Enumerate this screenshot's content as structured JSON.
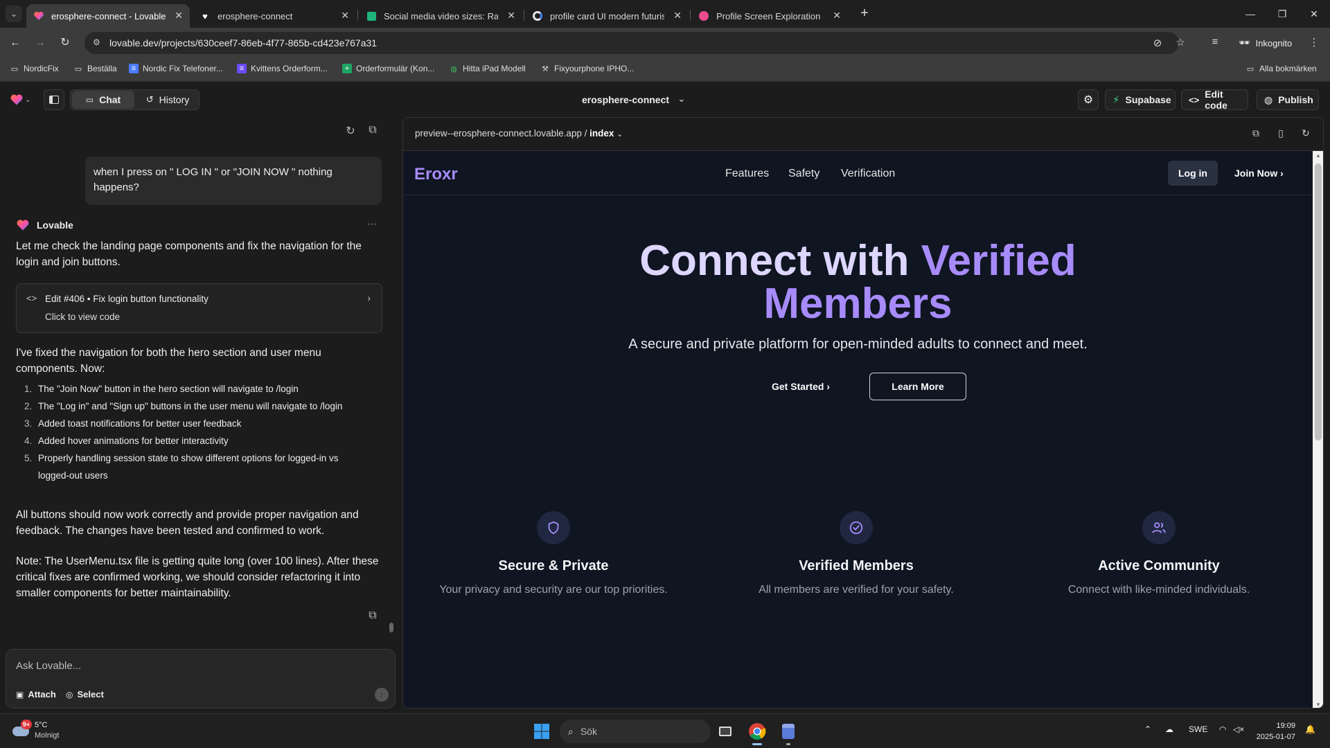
{
  "browser": {
    "tabs": [
      {
        "title": "erosphere-connect - Lovable",
        "icon": "lovable-heart-icon",
        "active": true
      },
      {
        "title": "erosphere-connect",
        "icon": "heart-icon",
        "active": false
      },
      {
        "title": "Social media video sizes: Ratios...",
        "icon": "sheet-icon",
        "active": false
      },
      {
        "title": "profile card UI modern futuristic",
        "icon": "google-icon",
        "active": false
      },
      {
        "title": "Profile Screen Explorations by T...",
        "icon": "dribbble-icon",
        "active": false
      }
    ],
    "url": "lovable.dev/projects/630ceef7-86eb-4f77-865b-cd423e767a31",
    "incognito_label": "Inkognito",
    "bookmarks": [
      {
        "label": "NordicFix",
        "icon": "folder-icon"
      },
      {
        "label": "Beställa",
        "icon": "folder-icon"
      },
      {
        "label": "Nordic Fix Telefoner...",
        "icon": "doc-icon"
      },
      {
        "label": "Kvittens Orderform...",
        "icon": "form-icon"
      },
      {
        "label": "Orderformulär (Kon...",
        "icon": "sheet-icon"
      },
      {
        "label": "Hitta iPad Modell",
        "icon": "globe-icon"
      },
      {
        "label": "Fixyourphone IPHO...",
        "icon": "tool-icon"
      }
    ],
    "all_bookmarks_label": "Alla bokmärken"
  },
  "app": {
    "tabs": {
      "chat": "Chat",
      "history": "History"
    },
    "project_name": "erosphere-connect",
    "actions": {
      "supabase": "Supabase",
      "edit_code": "Edit code",
      "publish": "Publish"
    }
  },
  "chat": {
    "user_message": "when I press on \" LOG IN \" or \"JOIN NOW \" nothing happens?",
    "author": "Lovable",
    "intro": "Let me check the landing page components and fix the navigation for the login and join buttons.",
    "edit_card": {
      "title": "Edit #406 • Fix login button functionality",
      "subtitle": "Click to view code"
    },
    "summary": "I've fixed the navigation for both the hero section and user menu components. Now:",
    "list": [
      "The \"Join Now\" button in the hero section will navigate to /login",
      "The \"Log in\" and \"Sign up\" buttons in the user menu will navigate to /login",
      "Added toast notifications for better user feedback",
      "Added hover animations for better interactivity",
      "Properly handling session state to show different options for logged-in vs logged-out users"
    ],
    "closing": "All buttons should now work correctly and provide proper navigation and feedback. The changes have been tested and confirmed to work.",
    "note": "Note: The UserMenu.tsx file is getting quite long (over 100 lines). After these critical fixes are confirmed working, we should consider refactoring it into smaller components for better maintainability.",
    "composer": {
      "placeholder": "Ask Lovable...",
      "attach": "Attach",
      "select": "Select"
    }
  },
  "preview": {
    "url_prefix": "preview--erosphere-connect.lovable.app / ",
    "url_page": "index",
    "site": {
      "logo": "Eroxr",
      "nav": [
        "Features",
        "Safety",
        "Verification"
      ],
      "login": "Log in",
      "join": "Join Now",
      "hero_line1": "Connect with",
      "hero_line1_accent": "Verified",
      "hero_line2": "Members",
      "subtitle": "A secure and private platform for open-minded adults to connect and meet.",
      "get_started": "Get Started",
      "learn_more": "Learn More",
      "features": [
        {
          "title": "Secure & Private",
          "desc": "Your privacy and security are our top priorities.",
          "icon": "shield-icon"
        },
        {
          "title": "Verified Members",
          "desc": "All members are verified for your safety.",
          "icon": "check-circle-icon"
        },
        {
          "title": "Active Community",
          "desc": "Connect with like-minded individuals.",
          "icon": "users-icon"
        }
      ],
      "colors": {
        "accent": "#a78bfa",
        "accent_light": "#ddd6fe",
        "background": "#0f1521"
      }
    }
  },
  "taskbar": {
    "weather_temp": "5°C",
    "weather_text": "Molnigt",
    "weather_badge": "9+",
    "search": "Sök",
    "lang": "SWE",
    "time": "19:09",
    "date": "2025-01-07"
  }
}
